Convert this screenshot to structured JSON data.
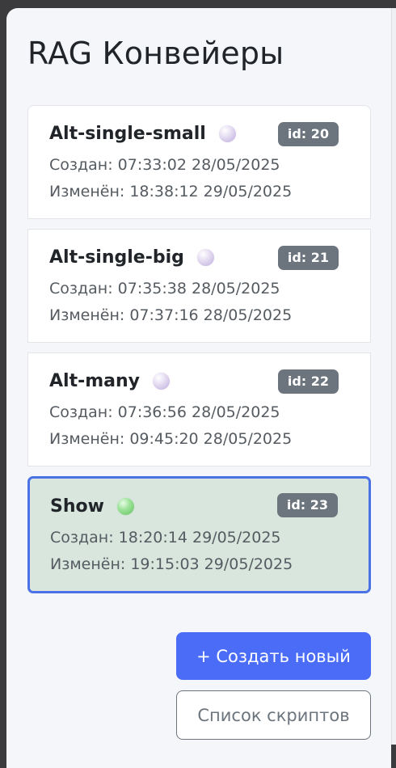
{
  "page": {
    "title": "RAG Конвейеры"
  },
  "pipelines": [
    {
      "name": "Alt-single-small",
      "id_label": "id: 20",
      "created": "Создан: 07:33:02 28/05/2025",
      "modified": "Изменён: 18:38:12 29/05/2025",
      "status": "inactive",
      "selected": false
    },
    {
      "name": "Alt-single-big",
      "id_label": "id: 21",
      "created": "Создан: 07:35:38 28/05/2025",
      "modified": "Изменён: 07:37:16 28/05/2025",
      "status": "inactive",
      "selected": false
    },
    {
      "name": "Alt-many",
      "id_label": "id: 22",
      "created": "Создан: 07:36:56 28/05/2025",
      "modified": "Изменён: 09:45:20 28/05/2025",
      "status": "inactive",
      "selected": false
    },
    {
      "name": "Show",
      "id_label": "id: 23",
      "created": "Создан: 18:20:14 29/05/2025",
      "modified": "Изменён: 19:15:03 29/05/2025",
      "status": "active",
      "selected": true
    }
  ],
  "actions": {
    "create_label": "+ Создать новый",
    "scripts_label": "Список скриптов"
  },
  "colors": {
    "accent": "#4a6cf7",
    "selected_bg": "#d8e6de",
    "selected_border": "#4a72e6",
    "badge_bg": "#6c757d",
    "status_active": "#7fd47c",
    "status_inactive": "#d9cdec"
  },
  "icons": {
    "status_inactive": "status-dot-inactive-icon",
    "status_active": "status-dot-active-icon"
  }
}
